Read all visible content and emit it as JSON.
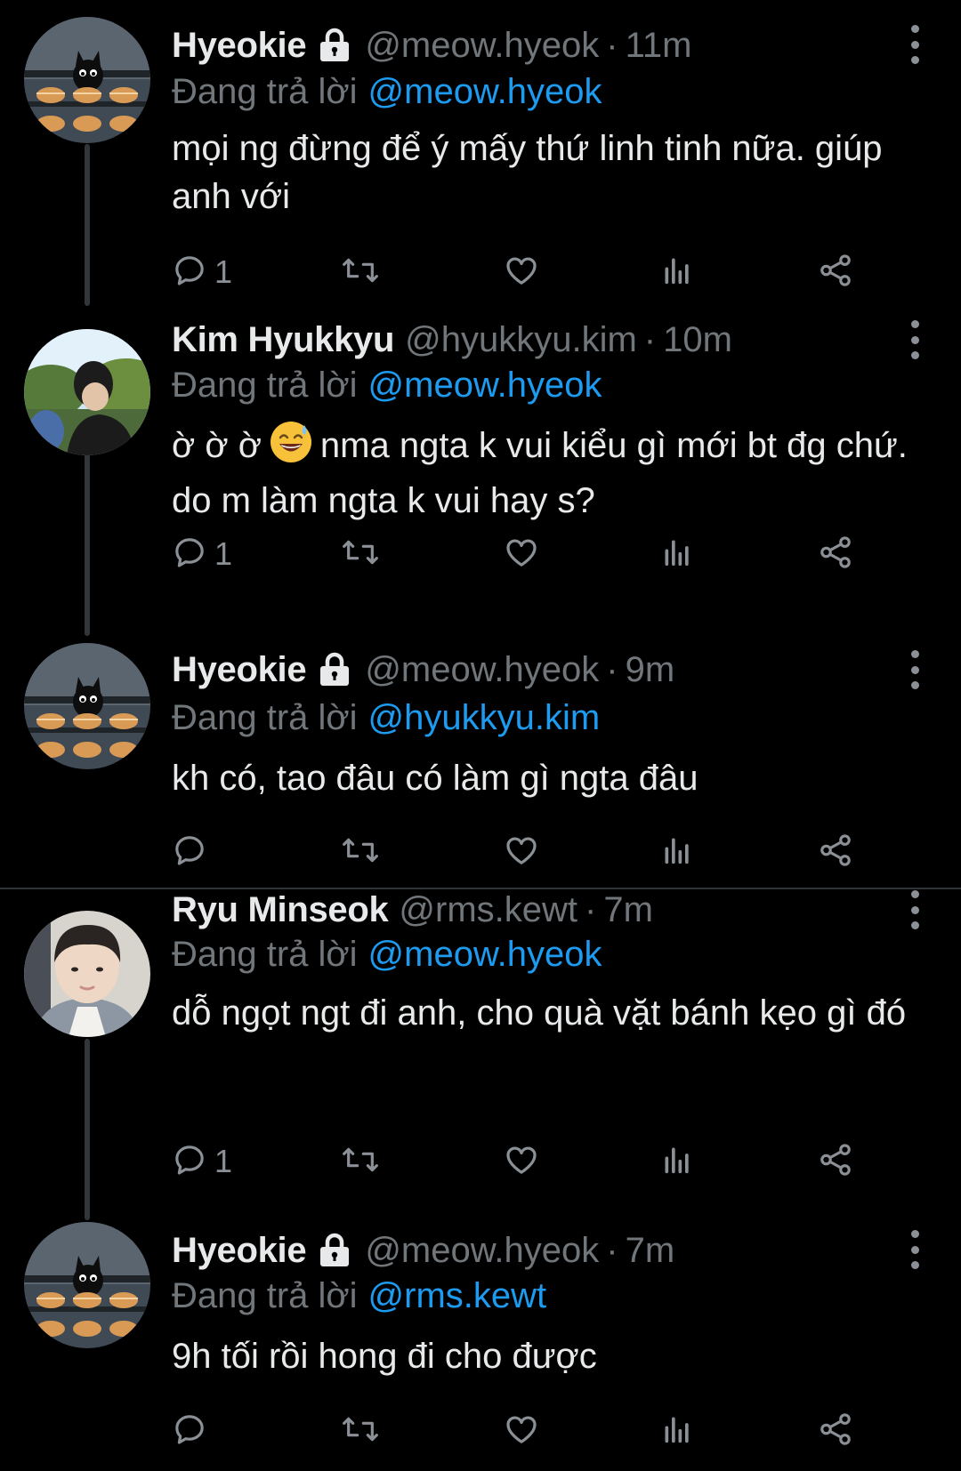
{
  "reply_prefix": "Đang trả lời",
  "colors": {
    "background": "#000000",
    "text": "#e7e9ea",
    "muted": "#71767b",
    "accent": "#1d9bf0"
  },
  "tweets": [
    {
      "name": "Hyeokie",
      "protected": true,
      "handle": "@meow.hyeok",
      "time": "11m",
      "reply_to": "@meow.hyeok",
      "text": "mọi ng đừng để ý mấy thứ linh tinh nữa. giúp anh với",
      "reply_count": "1",
      "avatar": "black-cat-with-bread-avatar"
    },
    {
      "name": "Kim Hyukkyu",
      "protected": false,
      "handle": "@hyukkyu.kim",
      "time": "10m",
      "reply_to": "@meow.hyeok",
      "text_before_emoji": "ờ ờ ờ",
      "emoji": "grinning-face-with-sweat-emoji",
      "text_after_emoji": "nma ngta k vui kiểu gì mới bt đg chứ. do m làm ngta k vui hay s?",
      "reply_count": "1",
      "avatar": "person-in-park-avatar"
    },
    {
      "name": "Hyeokie",
      "protected": true,
      "handle": "@meow.hyeok",
      "time": "9m",
      "reply_to": "@hyukkyu.kim",
      "text": "kh có, tao đâu có làm gì ngta đâu",
      "reply_count": "",
      "avatar": "black-cat-with-bread-avatar"
    },
    {
      "name": "Ryu Minseok",
      "protected": false,
      "handle": "@rms.kewt",
      "time": "7m",
      "reply_to": "@meow.hyeok",
      "text": "dỗ ngọt ngt đi anh, cho quà vặt bánh kẹo gì đó",
      "reply_count": "1",
      "avatar": "young-man-portrait-avatar"
    },
    {
      "name": "Hyeokie",
      "protected": true,
      "handle": "@meow.hyeok",
      "time": "7m",
      "reply_to": "@rms.kewt",
      "text": "9h tối rồi hong đi cho được",
      "reply_count": "",
      "avatar": "black-cat-with-bread-avatar"
    }
  ]
}
